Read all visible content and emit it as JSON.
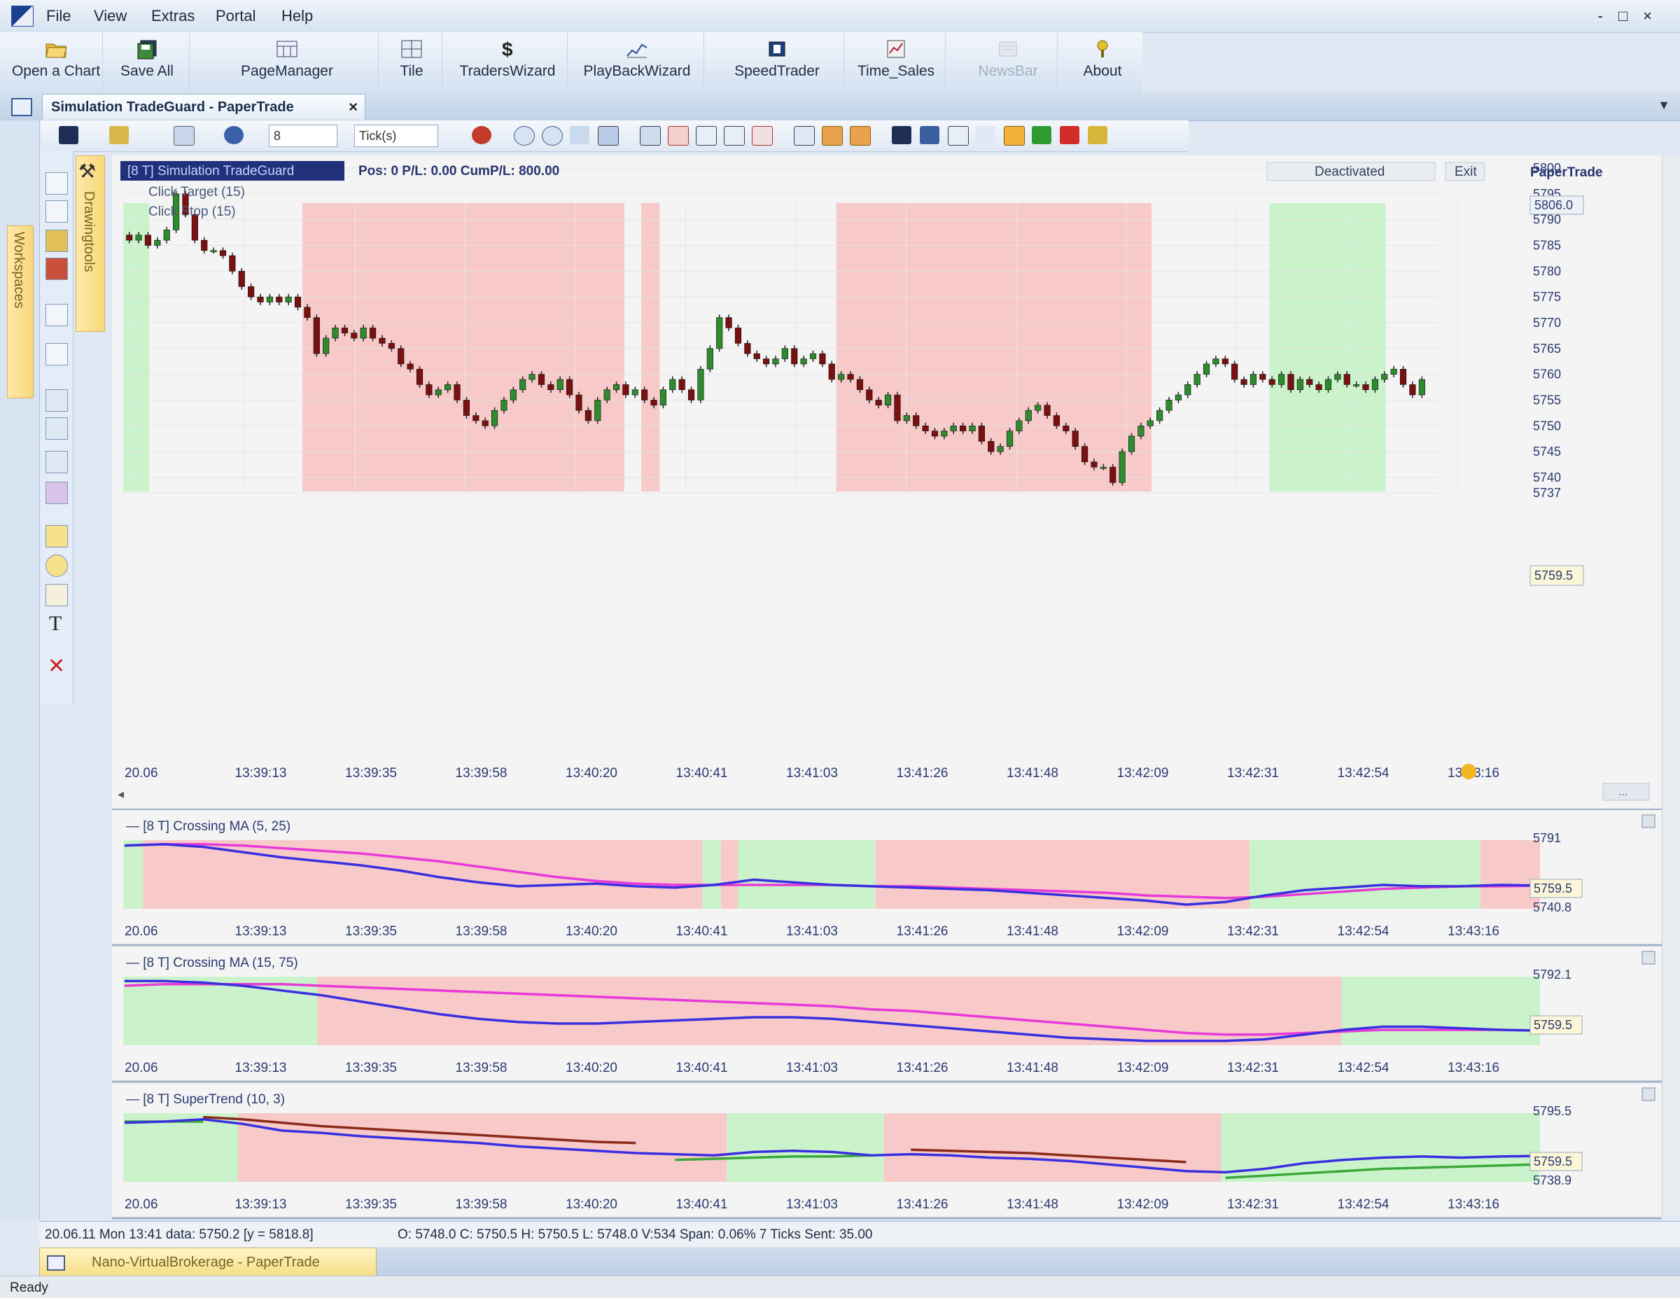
{
  "menu": [
    "File",
    "View",
    "Extras",
    "Portal",
    "Help"
  ],
  "window_buttons": [
    "-",
    "□",
    "×"
  ],
  "toolbar": [
    {
      "label": "Open a Chart",
      "icon": "folder-icon",
      "enabled": true
    },
    {
      "label": "Save All",
      "icon": "save-all-icon",
      "enabled": true
    },
    {
      "label": "PageManager",
      "icon": "page-manager-icon",
      "enabled": true
    },
    {
      "label": "Tile",
      "icon": "tile-icon",
      "enabled": true
    },
    {
      "label": "TradersWizard",
      "icon": "dollar-icon",
      "enabled": true
    },
    {
      "label": "PlayBackWizard",
      "icon": "playback-icon",
      "enabled": true
    },
    {
      "label": "SpeedTrader",
      "icon": "speedtrader-icon",
      "enabled": true
    },
    {
      "label": "Time_Sales",
      "icon": "time-sales-icon",
      "enabled": true
    },
    {
      "label": "NewsBar",
      "icon": "news-icon",
      "enabled": false
    },
    {
      "label": "About",
      "icon": "about-icon",
      "enabled": true
    }
  ],
  "tab": {
    "title": "Simulation TradeGuard - PaperTrade",
    "close": "×",
    "dropdown": "▼"
  },
  "toolbar2": {
    "period_value": "8",
    "period_unit": "Tick(s)"
  },
  "side_tabs": {
    "workspaces": "Workspaces",
    "drawing": "Drawingtools"
  },
  "colors": {
    "red_zone": "#f7c9c9",
    "green_zone": "#cbf3cb",
    "bull": "#2e8b2e",
    "bear": "#7a1010",
    "fast_ma": "#3a2fe0",
    "slow_ma": "#e83ad8",
    "trend_down": "#8b2a1a",
    "trend_up": "#3aa83a"
  },
  "main": {
    "header_box": "[8 T] Simulation TradeGuard",
    "pos": "Pos: 0  P/L: 0.00  CumP/L: 800.00",
    "lines": [
      "Click Target  (15)",
      "Click Stop  (15)"
    ],
    "status_btn": "Deactivated",
    "exit_btn": "Exit",
    "account": "PaperTrade",
    "price_top": "5806.0",
    "price_last": "5759.5",
    "scroll_btn": "..."
  },
  "x_labels": [
    "20.06",
    "13:39:13",
    "13:39:35",
    "13:39:58",
    "13:40:20",
    "13:40:41",
    "13:41:03",
    "13:41:26",
    "13:41:48",
    "13:42:09",
    "13:42:31",
    "13:42:54",
    "13:43:16"
  ],
  "chart_data": {
    "type": "candlestick",
    "ylim": [
      5737,
      5806
    ],
    "y_ticks": [
      5800,
      5795,
      5790,
      5785,
      5780,
      5775,
      5770,
      5765,
      5760,
      5755,
      5750,
      5745,
      5740,
      5737
    ],
    "closes": [
      5786,
      5787,
      5785,
      5786,
      5788,
      5795,
      5791,
      5786,
      5784,
      5784,
      5783,
      5780,
      5777,
      5775,
      5774,
      5775,
      5774,
      5775,
      5773,
      5771,
      5764,
      5767,
      5769,
      5768,
      5767,
      5769,
      5767,
      5766,
      5765,
      5762,
      5761,
      5758,
      5756,
      5757,
      5758,
      5755,
      5752,
      5751,
      5750,
      5753,
      5755,
      5757,
      5759,
      5760,
      5758,
      5757,
      5759,
      5756,
      5753,
      5751,
      5755,
      5757,
      5758,
      5756,
      5757,
      5755,
      5754,
      5757,
      5759,
      5757,
      5755,
      5761,
      5765,
      5771,
      5769,
      5766,
      5764,
      5763,
      5762,
      5763,
      5765,
      5762,
      5763,
      5764,
      5762,
      5759,
      5760,
      5759,
      5757,
      5755,
      5754,
      5756,
      5751,
      5752,
      5750,
      5749,
      5748,
      5749,
      5750,
      5749,
      5750,
      5747,
      5745,
      5746,
      5749,
      5751,
      5753,
      5754,
      5752,
      5750,
      5749,
      5746,
      5743,
      5742,
      5742,
      5739,
      5745,
      5748,
      5750,
      5751,
      5753,
      5755,
      5756,
      5758,
      5760,
      5762,
      5763,
      5762,
      5759,
      5758,
      5760,
      5759,
      5758,
      5760,
      5757,
      5759,
      5758,
      5757,
      5759,
      5760,
      5758,
      5758,
      5757,
      5759,
      5760,
      5761,
      5758,
      5756,
      5759
    ]
  },
  "zones_main": [
    {
      "c": "green",
      "a": 0,
      "b": 0.02
    },
    {
      "c": "red",
      "a": 0.137,
      "b": 0.383
    },
    {
      "c": "red",
      "a": 0.396,
      "b": 0.41
    },
    {
      "c": "red",
      "a": 0.545,
      "b": 0.786
    },
    {
      "c": "green",
      "a": 0.876,
      "b": 0.965
    }
  ],
  "indicators": [
    {
      "title": "[8 T] Crossing MA  (5, 25)",
      "top": "5791",
      "last": "5759.5",
      "bottom": "5740.8",
      "zones": [
        {
          "c": "green",
          "a": 0,
          "b": 0.014
        },
        {
          "c": "red",
          "a": 0.014,
          "b": 0.409
        },
        {
          "c": "green",
          "a": 0.409,
          "b": 0.422
        },
        {
          "c": "red",
          "a": 0.422,
          "b": 0.434
        },
        {
          "c": "green",
          "a": 0.434,
          "b": 0.531
        },
        {
          "c": "red",
          "a": 0.531,
          "b": 0.795
        },
        {
          "c": "green",
          "a": 0.795,
          "b": 0.958
        },
        {
          "c": "red",
          "a": 0.958,
          "b": 1
        }
      ],
      "fast": [
        5790,
        5791,
        5789,
        5785,
        5781,
        5778,
        5775,
        5771,
        5766,
        5762,
        5759,
        5760,
        5761,
        5759,
        5758,
        5760,
        5764,
        5762,
        5760,
        5759,
        5758,
        5757,
        5756,
        5754,
        5752,
        5750,
        5748,
        5745,
        5747,
        5752,
        5756,
        5758,
        5760,
        5759,
        5759,
        5760,
        5759.5
      ],
      "slow": [
        5790,
        5791,
        5791,
        5790,
        5788,
        5786,
        5784,
        5781,
        5778,
        5774,
        5770,
        5766,
        5763,
        5761,
        5760,
        5760,
        5760,
        5760,
        5760,
        5759,
        5759,
        5758,
        5757,
        5756,
        5755,
        5754,
        5752,
        5751,
        5750,
        5751,
        5753,
        5755,
        5757,
        5758,
        5759,
        5759,
        5759.5
      ]
    },
    {
      "title": "[8 T] Crossing MA  (15, 75)",
      "top": "5792.1",
      "last": "5759.5",
      "bottom": "",
      "zones": [
        {
          "c": "green",
          "a": 0,
          "b": 0.137
        },
        {
          "c": "red",
          "a": 0.137,
          "b": 0.86
        },
        {
          "c": "green",
          "a": 0.86,
          "b": 1
        }
      ],
      "fast": [
        5791,
        5791,
        5790,
        5788,
        5785,
        5782,
        5778,
        5774,
        5770,
        5767,
        5765,
        5764,
        5764,
        5765,
        5766,
        5767,
        5768,
        5768,
        5767,
        5765,
        5763,
        5761,
        5759,
        5757,
        5755,
        5754,
        5753,
        5753,
        5753,
        5754,
        5757,
        5760,
        5762,
        5762,
        5761,
        5760,
        5759.5
      ],
      "slow": [
        5788,
        5789,
        5789,
        5789,
        5789,
        5788,
        5787,
        5786,
        5785,
        5784,
        5783,
        5782,
        5781,
        5780,
        5779,
        5778,
        5777,
        5776,
        5775,
        5773,
        5772,
        5770,
        5768,
        5766,
        5764,
        5762,
        5760,
        5758,
        5757,
        5757,
        5758,
        5759,
        5760,
        5760,
        5760,
        5760,
        5759.5
      ]
    },
    {
      "title": "[8 T] SuperTrend  (10, 3)",
      "top": "5795.5",
      "last": "5759.5",
      "bottom": "5738.9",
      "zones": [
        {
          "c": "green",
          "a": 0,
          "b": 0.081
        },
        {
          "c": "red",
          "a": 0.081,
          "b": 0.426
        },
        {
          "c": "green",
          "a": 0.426,
          "b": 0.537
        },
        {
          "c": "red",
          "a": 0.537,
          "b": 0.775
        },
        {
          "c": "green",
          "a": 0.775,
          "b": 1
        }
      ],
      "price": [
        5789,
        5790,
        5792,
        5788,
        5782,
        5780,
        5777,
        5775,
        5773,
        5771,
        5768,
        5766,
        5764,
        5762,
        5761,
        5760,
        5763,
        5764,
        5763,
        5760,
        5761,
        5760,
        5758,
        5757,
        5755,
        5752,
        5749,
        5746,
        5745,
        5748,
        5753,
        5756,
        5758,
        5759,
        5758,
        5759,
        5759.5
      ],
      "down": [
        null,
        null,
        5794,
        5792,
        5789,
        5786,
        5784,
        5782,
        5780,
        5778,
        5776,
        5774,
        5772,
        5771,
        null,
        null,
        null,
        null,
        null,
        null,
        5765,
        5764,
        5763,
        5762,
        5760,
        5758,
        5756,
        5754,
        null,
        null,
        null,
        null,
        null,
        null,
        null,
        null,
        null
      ],
      "up": [
        5790,
        5790,
        5790,
        null,
        null,
        null,
        null,
        null,
        null,
        null,
        null,
        null,
        null,
        null,
        5756,
        5757,
        5758,
        5759,
        5759,
        5760,
        null,
        null,
        null,
        null,
        null,
        null,
        null,
        null,
        5740,
        5742,
        5744,
        5746,
        5748,
        5749,
        5750,
        5751,
        5752
      ]
    }
  ],
  "status": {
    "left": "20.06.11 Mon 13:41 data: 5750.2 [y = 5818.8]",
    "ohlc": "O: 5748.0 C: 5750.5 H: 5750.5 L: 5748.0 V:534 Span: 0.06% 7 Ticks Sent: 35.00",
    "workspace": "Nano-VirtualBrokerage - PaperTrade",
    "ready": "Ready"
  }
}
